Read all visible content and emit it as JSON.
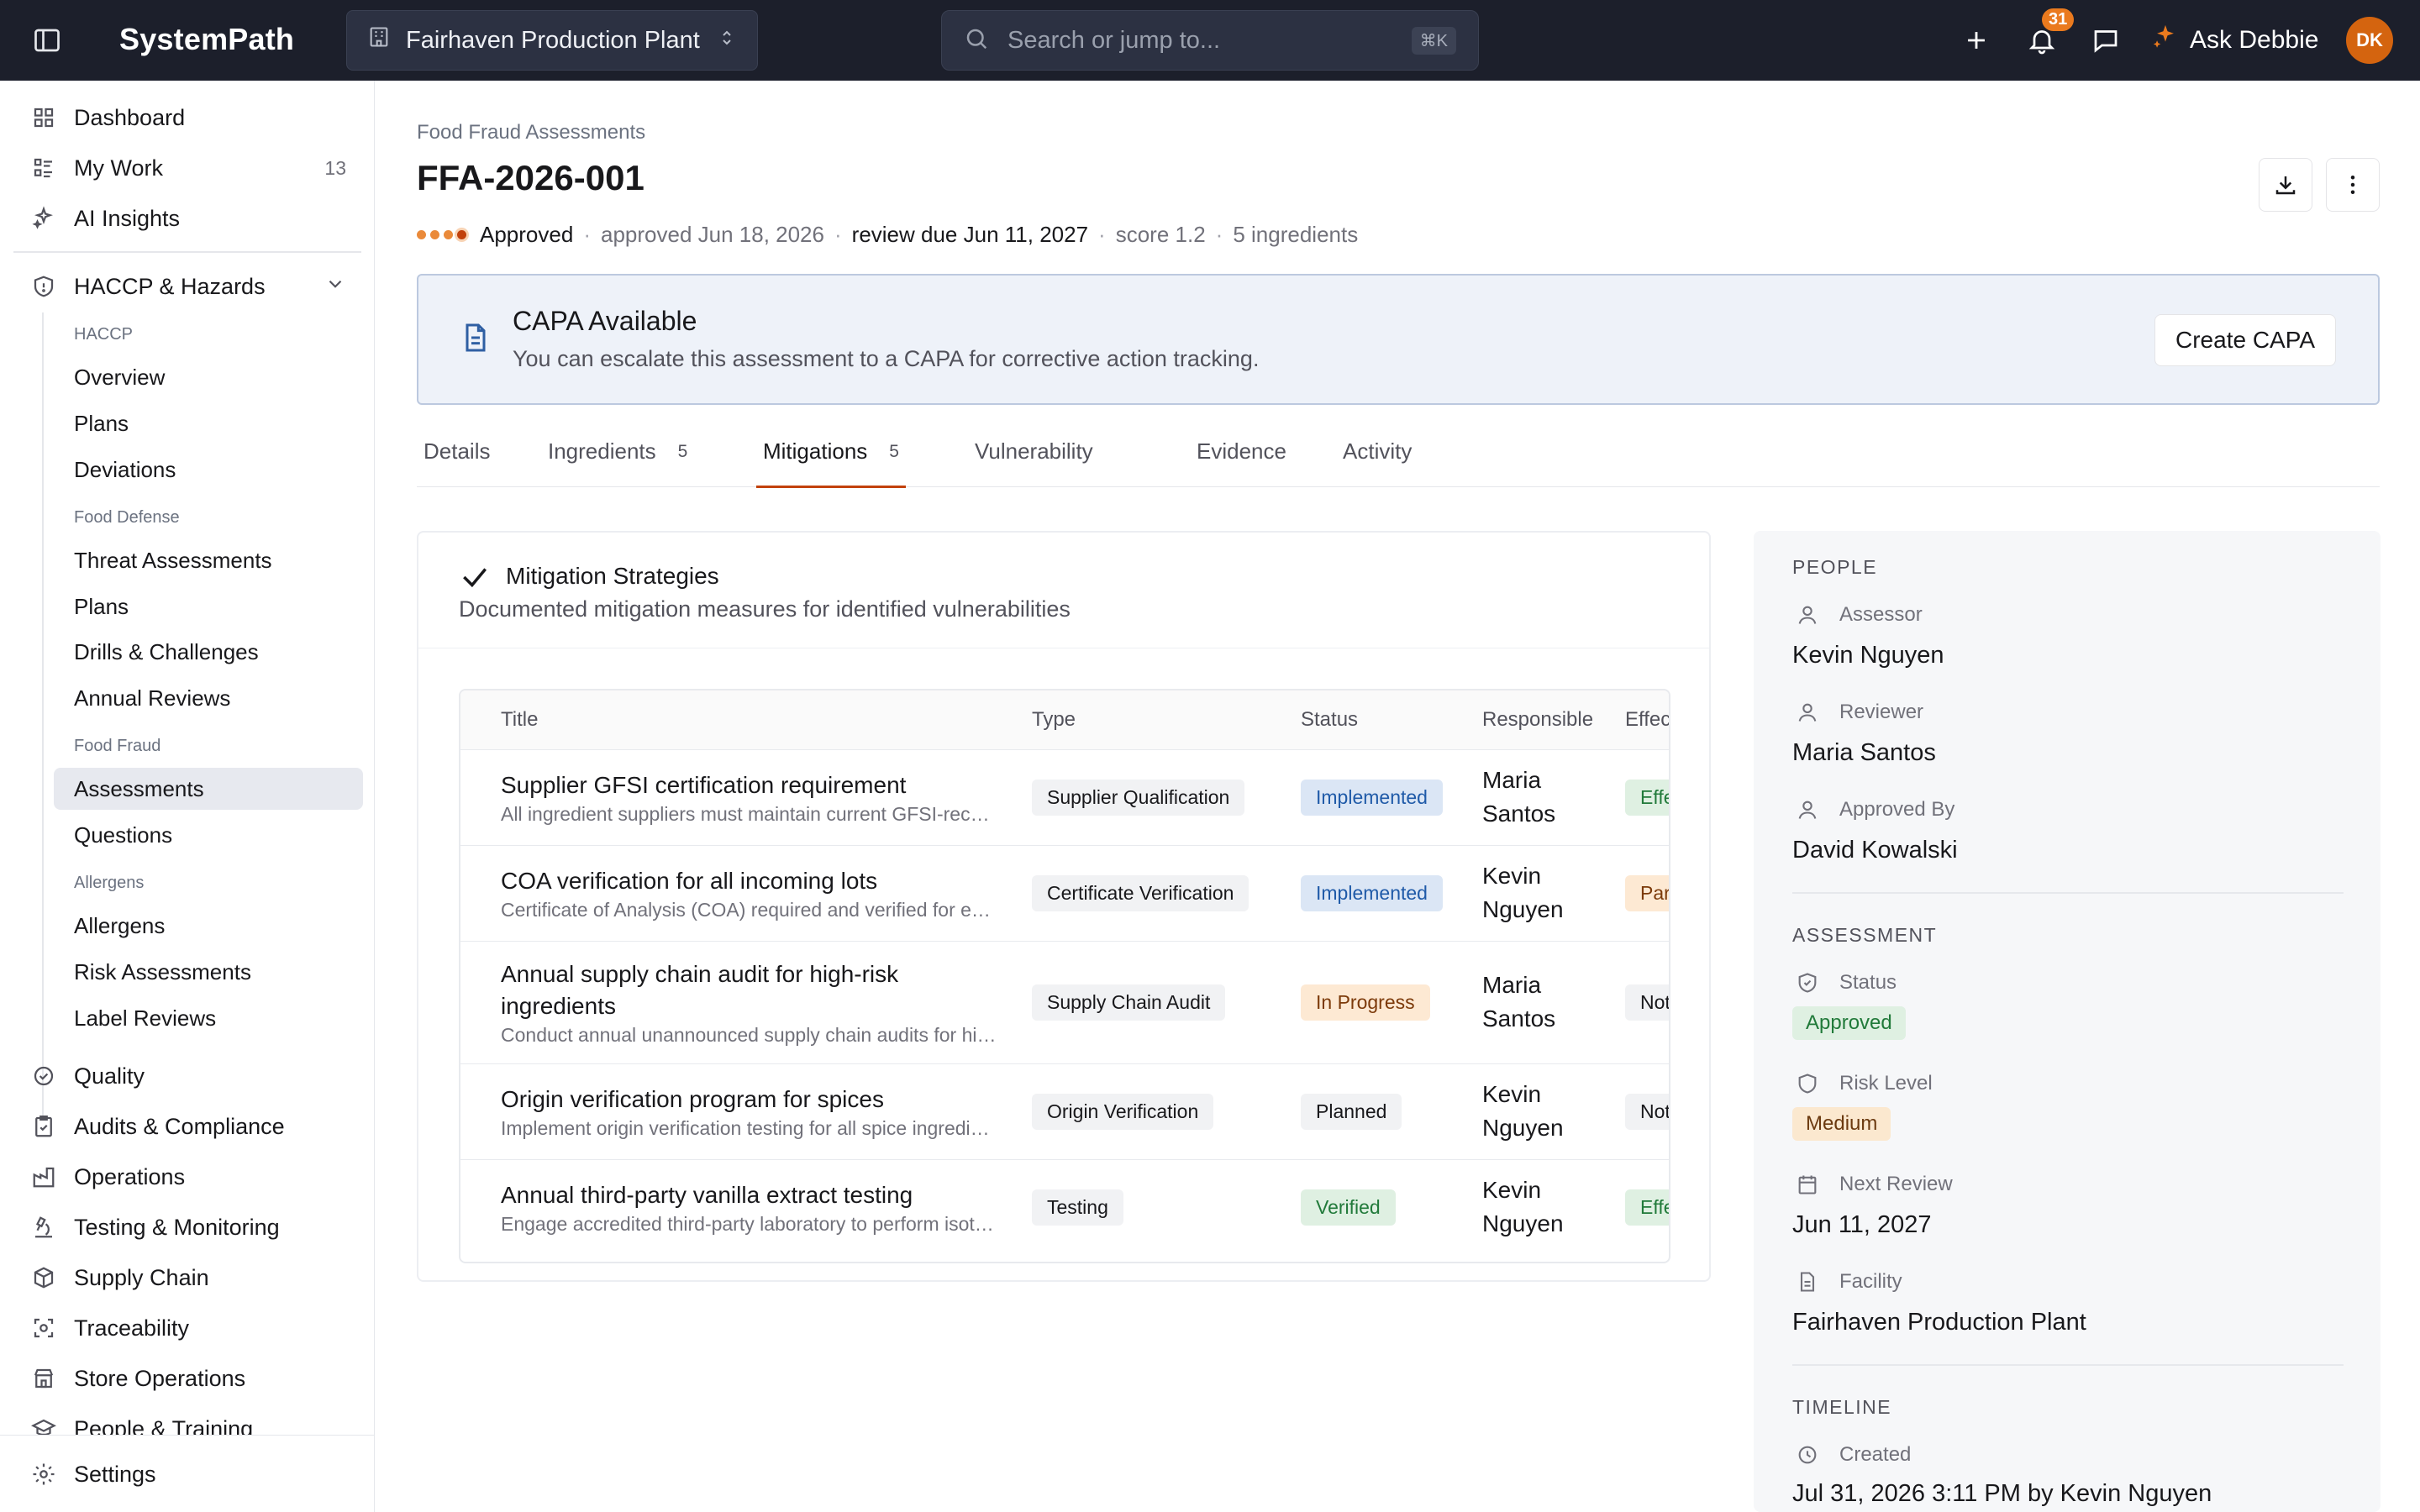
{
  "topbar": {
    "brand": "SystemPath",
    "facility": "Fairhaven Production Plant",
    "search_placeholder": "Search or jump to...",
    "search_shortcut": "⌘K",
    "notifications_count": "31",
    "ask_label": "Ask Debbie",
    "avatar_initials": "DK",
    "accent_color": "#ea7a1e"
  },
  "sidebar": {
    "top_items": [
      {
        "label": "Dashboard",
        "icon": "grid-icon"
      },
      {
        "label": "My Work",
        "count": "13",
        "icon": "list-icon"
      },
      {
        "label": "AI Insights",
        "icon": "sparkle-icon"
      }
    ],
    "haccp": {
      "label": "HACCP & Hazards",
      "groups": [
        {
          "heading": "HACCP",
          "items": [
            "Overview",
            "Plans",
            "Deviations"
          ]
        },
        {
          "heading": "Food Defense",
          "items": [
            "Threat Assessments",
            "Plans",
            "Drills & Challenges",
            "Annual Reviews"
          ]
        },
        {
          "heading": "Food Fraud",
          "items": [
            "Assessments",
            "Questions"
          ]
        },
        {
          "heading": "Allergens",
          "items": [
            "Allergens",
            "Risk Assessments",
            "Label Reviews"
          ]
        }
      ]
    },
    "bottom_items": [
      {
        "label": "Quality"
      },
      {
        "label": "Audits & Compliance"
      },
      {
        "label": "Operations"
      },
      {
        "label": "Testing & Monitoring"
      },
      {
        "label": "Supply Chain"
      },
      {
        "label": "Traceability"
      },
      {
        "label": "Store Operations"
      },
      {
        "label": "People & Training"
      }
    ],
    "settings_label": "Settings"
  },
  "page": {
    "breadcrumb": "Food Fraud Assessments",
    "title": "FFA-2026-001",
    "meta": {
      "status": "Approved",
      "approved": "approved Jun 18, 2026",
      "review_due": "review due Jun 11, 2027",
      "score": "score 1.2",
      "ingredients": "5 ingredients"
    },
    "capa": {
      "title": "CAPA Available",
      "description": "You can escalate this assessment to a CAPA for corrective action tracking.",
      "button": "Create CAPA"
    },
    "tabs": [
      {
        "label": "Details"
      },
      {
        "label": "Ingredients",
        "count": "5"
      },
      {
        "label": "Mitigations",
        "count": "5"
      },
      {
        "label": "Vulnerability"
      },
      {
        "label": "Evidence"
      },
      {
        "label": "Activity"
      }
    ]
  },
  "mitigations": {
    "title": "Mitigation Strategies",
    "description": "Documented mitigation measures for identified vulnerabilities",
    "columns": [
      "Title",
      "Type",
      "Status",
      "Responsible",
      "Effectiveness"
    ],
    "rows": [
      {
        "title": "Supplier GFSI certification requirement",
        "desc": "All ingredient suppliers must maintain current GFSI-recognized certification",
        "type": "Supplier Qualification",
        "status": "Implemented",
        "responsible": [
          "Maria",
          "Santos"
        ],
        "effect": "Effective"
      },
      {
        "title": "COA verification for all incoming lots",
        "desc": "Certificate of Analysis (COA) required and verified for every incoming lot",
        "type": "Certificate Verification",
        "status": "Implemented",
        "responsible": [
          "Kevin",
          "Nguyen"
        ],
        "effect": "Partial"
      },
      {
        "title": "Annual supply chain audit for high-risk ingredients",
        "desc": "Conduct annual unannounced supply chain audits for high-risk ingredients",
        "type": "Supply Chain Audit",
        "status": "In Progress",
        "responsible": [
          "Maria",
          "Santos"
        ],
        "effect": "Not assessed"
      },
      {
        "title": "Origin verification program for spices",
        "desc": "Implement origin verification testing for all spice ingredients",
        "type": "Origin Verification",
        "status": "Planned",
        "responsible": [
          "Kevin",
          "Nguyen"
        ],
        "effect": "Not assessed"
      },
      {
        "title": "Annual third-party vanilla extract testing",
        "desc": "Engage accredited third-party laboratory to perform isotope testing",
        "type": "Testing",
        "status": "Verified",
        "responsible": [
          "Kevin",
          "Nguyen"
        ],
        "effect": "Effective"
      }
    ]
  },
  "panel": {
    "people_heading": "PEOPLE",
    "assessor_label": "Assessor",
    "assessor": "Kevin Nguyen",
    "reviewer_label": "Reviewer",
    "reviewer": "Maria Santos",
    "approved_by_label": "Approved By",
    "approved_by": "David Kowalski",
    "assessment_heading": "ASSESSMENT",
    "status_label": "Status",
    "status": "Approved",
    "risk_label": "Risk Level",
    "risk": "Medium",
    "next_review_label": "Next Review",
    "next_review": "Jun 11, 2027",
    "facility_label": "Facility",
    "facility": "Fairhaven Production Plant",
    "timeline_heading": "TIMELINE",
    "created_label": "Created",
    "created": "Jul 31, 2026 3:11 PM by Kevin Nguyen"
  }
}
